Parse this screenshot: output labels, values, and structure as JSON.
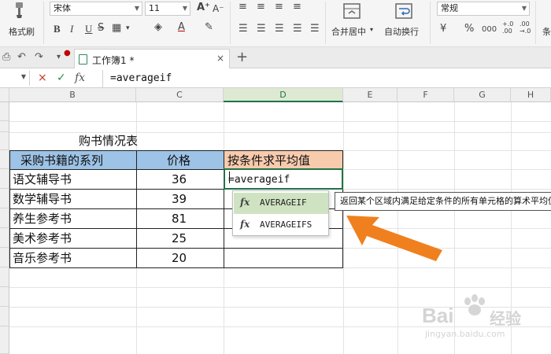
{
  "ribbon": {
    "format_painter_label": "格式刷",
    "font_name": "宋体",
    "font_size": "11",
    "merge_center_label": "合并居中",
    "wrap_text_label": "自动换行",
    "number_format": "常规",
    "bold_label": "B",
    "italic_label": "I",
    "underline_label": "U",
    "percent_label": "%",
    "comma_label": "000",
    "increase_decimal": "+.0\n.00",
    "decrease_decimal": ".00\n→.0",
    "truncated_label": "条"
  },
  "tabbar": {
    "doc_title": "工作簿1 *",
    "close": "×",
    "new_tab": "+"
  },
  "formula_bar": {
    "cancel": "×",
    "enter": "✓",
    "fx": "fx",
    "value": "=averageif"
  },
  "columns": [
    "B",
    "C",
    "D",
    "E",
    "F",
    "G",
    "H"
  ],
  "sheet": {
    "title": "购书情况表",
    "header": [
      "采购书籍的系列",
      "价格",
      "按条件求平均值"
    ],
    "rows": [
      {
        "series": "语文辅导书",
        "price": "36"
      },
      {
        "series": "数学辅导书",
        "price": "39"
      },
      {
        "series": "养生参考书",
        "price": "81"
      },
      {
        "series": "美术参考书",
        "price": "25"
      },
      {
        "series": "音乐参考书",
        "price": "20"
      }
    ],
    "editing_value": "=averageif"
  },
  "autocomplete": {
    "items": [
      {
        "icon": "fx",
        "name": "AVERAGEIF"
      },
      {
        "icon": "fx",
        "name": "AVERAGEIFS"
      }
    ],
    "tooltip": "返回某个区域内满足给定条件的所有单元格的算术平均值"
  },
  "watermark": {
    "brand": "Bai",
    "brand_cn": "经验",
    "url": "jingyan.baidu.com"
  },
  "colors": {
    "accent_green": "#217346",
    "header_blue": "#9dc3e6",
    "header_orange": "#f8cbad",
    "arrow_orange": "#f0801e"
  }
}
